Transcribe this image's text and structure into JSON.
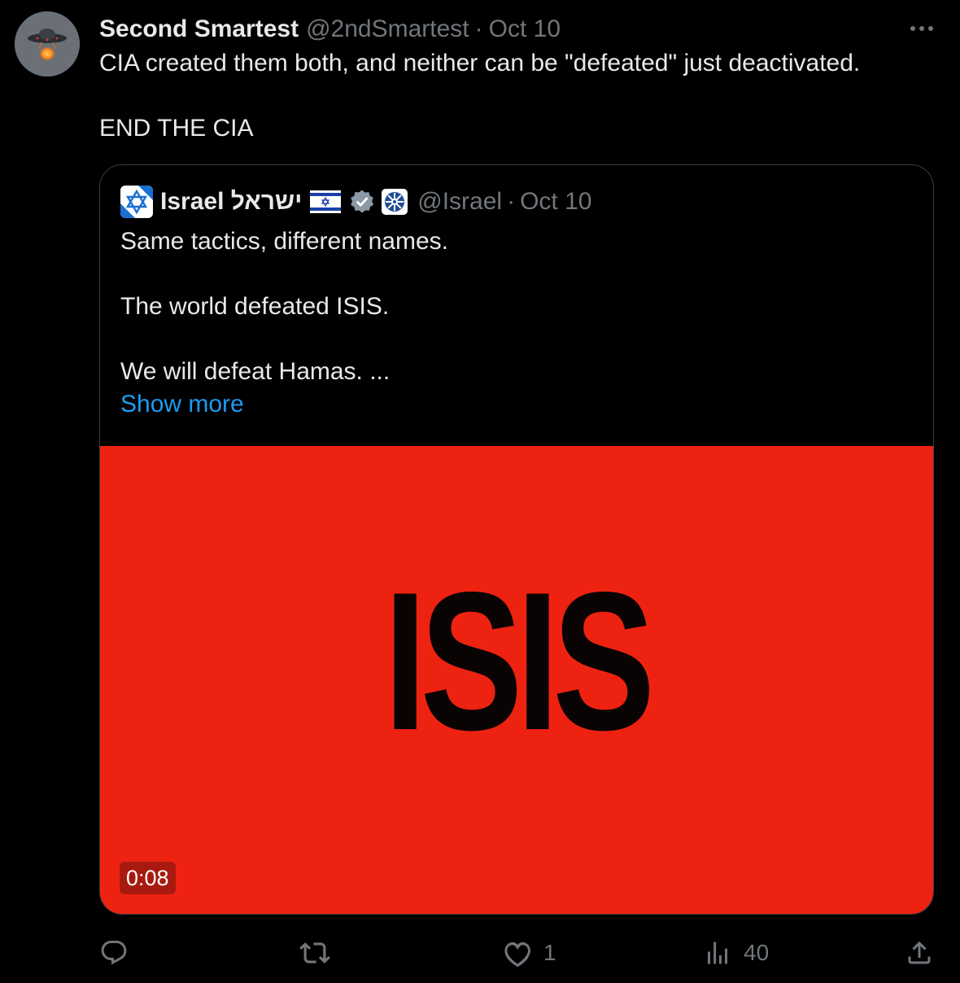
{
  "tweet": {
    "display_name": "Second Smartest",
    "handle": "@2ndSmartest",
    "separator": "·",
    "date": "Oct 10",
    "more_icon": "ellipsis-icon",
    "text_line_1": "CIA created them both, and neither can be \"defeated\" just deactivated.",
    "text_line_2": "END THE CIA"
  },
  "quoted": {
    "display_name": "Israel ישראל",
    "flag": "israel-flag-emoji",
    "verified_badge": "verified-badge-icon",
    "affiliation_badge": "affiliation-badge-icon",
    "handle": "@Israel",
    "separator": "·",
    "date": "Oct 10",
    "text_line_1": "Same tactics, different names.",
    "text_line_2": "The world defeated ISIS.",
    "text_line_3": "We will defeat Hamas. ...",
    "show_more": "Show more",
    "media": {
      "title": "ISIS",
      "duration": "0:08",
      "background_color": "#ee2211"
    }
  },
  "actions": {
    "reply_icon": "reply-icon",
    "retweet_icon": "retweet-icon",
    "like_icon": "heart-icon",
    "like_count": "1",
    "views_icon": "views-icon",
    "views_count": "40",
    "share_icon": "share-icon"
  },
  "colors": {
    "background": "#000000",
    "text": "#e7e9ea",
    "secondary_text": "#71767b",
    "link": "#1d9bf0",
    "border": "#3a3d40"
  }
}
